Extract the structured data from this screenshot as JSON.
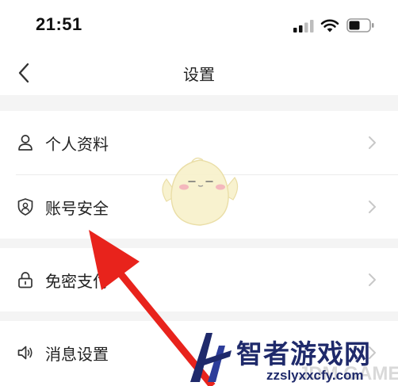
{
  "status_bar": {
    "time": "21:51"
  },
  "header": {
    "title": "设置",
    "back_icon": "chevron-left-icon"
  },
  "settings_items": [
    {
      "label": "个人资料",
      "icon": "person-icon"
    },
    {
      "label": "账号安全",
      "icon": "shield-icon"
    },
    {
      "label": "免密支付",
      "icon": "lock-icon"
    },
    {
      "label": "消息设置",
      "icon": "speaker-icon"
    }
  ],
  "watermark": {
    "title": "智者游戏网",
    "subtitle": "zzslyxxcfy.com",
    "brand": "JDM GAME"
  },
  "colors": {
    "background": "#ffffff",
    "section_gap": "#f4f4f4",
    "text": "#222222",
    "chevron": "#c8c8c8",
    "annotation_arrow": "#e8231c",
    "watermark_blue": "#1f2a6b"
  }
}
